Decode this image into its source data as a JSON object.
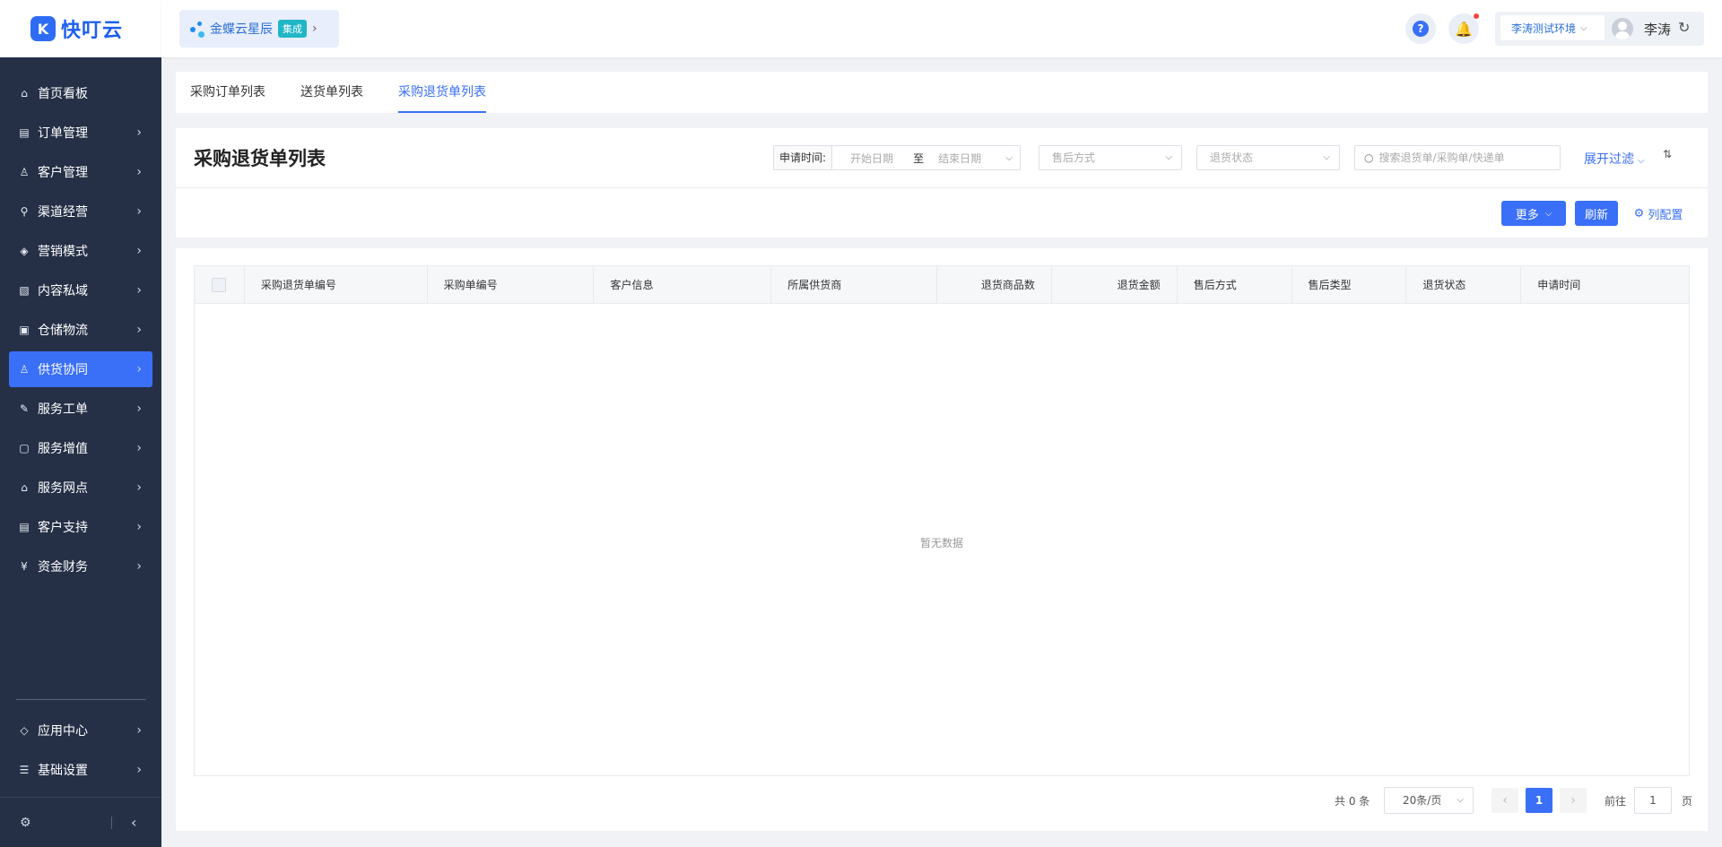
{
  "app": {
    "logo_glyph": "K",
    "logo_text": "快叮云"
  },
  "sidebar": {
    "items": [
      {
        "label": "首页看板",
        "icon": "⌂",
        "arrow": ""
      },
      {
        "label": "订单管理",
        "icon": "▤",
        "arrow": "›"
      },
      {
        "label": "客户管理",
        "icon": "♙",
        "arrow": "›"
      },
      {
        "label": "渠道经营",
        "icon": "⚲",
        "arrow": "›"
      },
      {
        "label": "营销模式",
        "icon": "◈",
        "arrow": "›"
      },
      {
        "label": "内容私域",
        "icon": "▧",
        "arrow": "›"
      },
      {
        "label": "仓储物流",
        "icon": "▣",
        "arrow": "›"
      },
      {
        "label": "供货协同",
        "icon": "♙",
        "arrow": "›"
      },
      {
        "label": "服务工单",
        "icon": "✎",
        "arrow": "›"
      },
      {
        "label": "服务增值",
        "icon": "▢",
        "arrow": "›"
      },
      {
        "label": "服务网点",
        "icon": "⌂",
        "arrow": "›"
      },
      {
        "label": "客户支持",
        "icon": "▤",
        "arrow": "›"
      },
      {
        "label": "资金财务",
        "icon": "¥",
        "arrow": "›"
      }
    ],
    "active_index": 7,
    "bottom_items": [
      {
        "label": "应用中心",
        "icon": "◇",
        "arrow": "›"
      },
      {
        "label": "基础设置",
        "icon": "☰",
        "arrow": "›"
      }
    ],
    "footer": {
      "settings_icon": "⚙",
      "collapse_icon": "‹"
    }
  },
  "header": {
    "org_name": "金蝶云星辰",
    "org_badge": "集成",
    "org_arrow": "›",
    "help_glyph": "?",
    "bell_glyph": "🔔",
    "env": "李涛测试环境",
    "user_name": "李涛",
    "refresh_glyph": "↻"
  },
  "tabs": [
    {
      "label": "采购订单列表"
    },
    {
      "label": "送货单列表"
    },
    {
      "label": "采购退货单列表"
    }
  ],
  "active_tab": 2,
  "page": {
    "title": "采购退货单列表",
    "filters": {
      "date_label": "申请时间:",
      "date_start": "开始日期",
      "date_to": "至",
      "date_end": "结束日期",
      "after_sale_mode": "售后方式",
      "return_status": "退货状态",
      "search_placeholder": "搜索退货单/采购单/快递单",
      "expand_label": "展开过滤"
    },
    "toolbar": {
      "more_label": "更多",
      "refresh_label": "刷新",
      "columns_label": "列配置"
    }
  },
  "table": {
    "columns": [
      "采购退货单编号",
      "采购单编号",
      "客户信息",
      "所属供货商",
      "退货商品数",
      "退货金额",
      "售后方式",
      "售后类型",
      "退货状态",
      "申请时间"
    ],
    "empty_text": "暂无数据"
  },
  "pagination": {
    "total": "共 0 条",
    "page_size": "20条/页",
    "current_page": "1",
    "goto_label": "前往",
    "goto_value": "1",
    "goto_unit": "页"
  },
  "colors": {
    "primary": "#3a6ff7",
    "sidebar_bg": "#253047",
    "badge": "#20b6c8"
  }
}
